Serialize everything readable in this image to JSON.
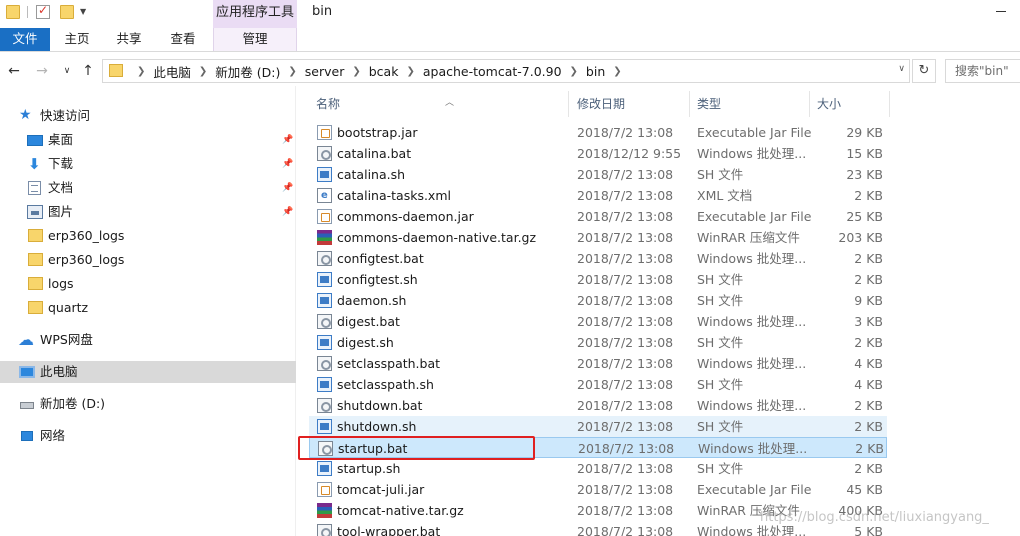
{
  "window": {
    "title": "bin"
  },
  "quick_access_toolbar": {
    "icons": [
      "folder-icon",
      "properties-check-icon",
      "new-folder-icon"
    ]
  },
  "ribbon": {
    "context_group": "应用程序工具",
    "tabs": [
      {
        "label": "文件"
      },
      {
        "label": "主页"
      },
      {
        "label": "共享"
      },
      {
        "label": "查看"
      },
      {
        "label": "管理"
      }
    ]
  },
  "address_bar": {
    "crumbs": [
      "此电脑",
      "新加卷 (D:)",
      "server",
      "bcak",
      "apache-tomcat-7.0.90",
      "bin"
    ],
    "search_placeholder": "搜索\"bin\""
  },
  "sidebar": {
    "items": [
      {
        "label": "快速访问",
        "icon": "quick-access-star-icon"
      },
      {
        "label": "桌面",
        "icon": "desktop-icon",
        "pinned": true
      },
      {
        "label": "下载",
        "icon": "download-icon",
        "pinned": true
      },
      {
        "label": "文档",
        "icon": "documents-icon",
        "pinned": true
      },
      {
        "label": "图片",
        "icon": "pictures-icon",
        "pinned": true
      },
      {
        "label": "erp360_logs",
        "icon": "folder-icon"
      },
      {
        "label": "erp360_logs",
        "icon": "folder-icon"
      },
      {
        "label": "logs",
        "icon": "folder-icon"
      },
      {
        "label": "quartz",
        "icon": "folder-icon"
      },
      {
        "label": "WPS网盘",
        "icon": "cloud-drive-icon"
      },
      {
        "label": "此电脑",
        "icon": "this-pc-icon",
        "selected": true
      },
      {
        "label": "新加卷 (D:)",
        "icon": "drive-icon"
      },
      {
        "label": "网络",
        "icon": "network-icon"
      }
    ]
  },
  "columns": {
    "name": "名称",
    "date": "修改日期",
    "type": "类型",
    "size": "大小"
  },
  "files": [
    {
      "name": "bootstrap.jar",
      "date": "2018/7/2 13:08",
      "type": "Executable Jar File",
      "size": "29 KB",
      "kind": "jar"
    },
    {
      "name": "catalina.bat",
      "date": "2018/12/12 9:55",
      "type": "Windows 批处理...",
      "size": "15 KB",
      "kind": "bat"
    },
    {
      "name": "catalina.sh",
      "date": "2018/7/2 13:08",
      "type": "SH 文件",
      "size": "23 KB",
      "kind": "sh"
    },
    {
      "name": "catalina-tasks.xml",
      "date": "2018/7/2 13:08",
      "type": "XML 文档",
      "size": "2 KB",
      "kind": "xml"
    },
    {
      "name": "commons-daemon.jar",
      "date": "2018/7/2 13:08",
      "type": "Executable Jar File",
      "size": "25 KB",
      "kind": "jar"
    },
    {
      "name": "commons-daemon-native.tar.gz",
      "date": "2018/7/2 13:08",
      "type": "WinRAR 压缩文件",
      "size": "203 KB",
      "kind": "rar"
    },
    {
      "name": "configtest.bat",
      "date": "2018/7/2 13:08",
      "type": "Windows 批处理...",
      "size": "2 KB",
      "kind": "bat"
    },
    {
      "name": "configtest.sh",
      "date": "2018/7/2 13:08",
      "type": "SH 文件",
      "size": "2 KB",
      "kind": "sh"
    },
    {
      "name": "daemon.sh",
      "date": "2018/7/2 13:08",
      "type": "SH 文件",
      "size": "9 KB",
      "kind": "sh"
    },
    {
      "name": "digest.bat",
      "date": "2018/7/2 13:08",
      "type": "Windows 批处理...",
      "size": "3 KB",
      "kind": "bat"
    },
    {
      "name": "digest.sh",
      "date": "2018/7/2 13:08",
      "type": "SH 文件",
      "size": "2 KB",
      "kind": "sh"
    },
    {
      "name": "setclasspath.bat",
      "date": "2018/7/2 13:08",
      "type": "Windows 批处理...",
      "size": "4 KB",
      "kind": "bat"
    },
    {
      "name": "setclasspath.sh",
      "date": "2018/7/2 13:08",
      "type": "SH 文件",
      "size": "4 KB",
      "kind": "sh"
    },
    {
      "name": "shutdown.bat",
      "date": "2018/7/2 13:08",
      "type": "Windows 批处理...",
      "size": "2 KB",
      "kind": "bat"
    },
    {
      "name": "shutdown.sh",
      "date": "2018/7/2 13:08",
      "type": "SH 文件",
      "size": "2 KB",
      "kind": "sh",
      "state": "hover"
    },
    {
      "name": "startup.bat",
      "date": "2018/7/2 13:08",
      "type": "Windows 批处理...",
      "size": "2 KB",
      "kind": "bat",
      "state": "selected"
    },
    {
      "name": "startup.sh",
      "date": "2018/7/2 13:08",
      "type": "SH 文件",
      "size": "2 KB",
      "kind": "sh"
    },
    {
      "name": "tomcat-juli.jar",
      "date": "2018/7/2 13:08",
      "type": "Executable Jar File",
      "size": "45 KB",
      "kind": "jar"
    },
    {
      "name": "tomcat-native.tar.gz",
      "date": "2018/7/2 13:08",
      "type": "WinRAR 压缩文件",
      "size": "400 KB",
      "kind": "rar"
    },
    {
      "name": "tool-wrapper.bat",
      "date": "2018/7/2 13:08",
      "type": "Windows 批处理...",
      "size": "5 KB",
      "kind": "bat"
    }
  ],
  "annotation": {
    "highlight_color": "#e02020",
    "highlighted_file": "startup.bat"
  },
  "watermark": "https://blog.csdn.net/liuxiangyang_",
  "colors": {
    "file_tab": "#1a6fc4",
    "context_tab": "#eadcf4",
    "selected_row": "#cde8fc",
    "hover_row": "#e6f2fb"
  }
}
